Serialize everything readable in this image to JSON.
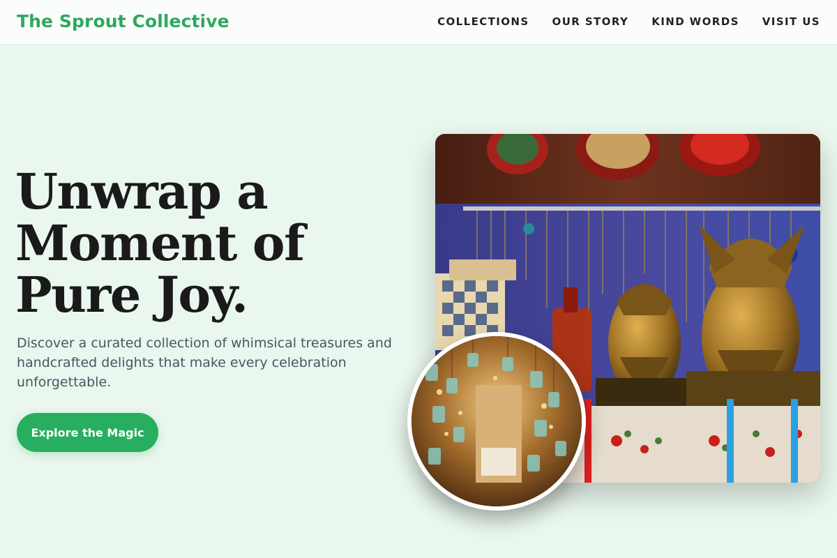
{
  "brand": {
    "name": "The Sprout Collective"
  },
  "nav": {
    "items": [
      {
        "label": "COLLECTIONS"
      },
      {
        "label": "OUR STORY"
      },
      {
        "label": "KIND WORDS"
      },
      {
        "label": "VISIT US"
      }
    ]
  },
  "hero": {
    "headline": "Unwrap a Moment of Pure Joy.",
    "subtitle": "Discover a curated collection of whimsical treasures and handcrafted delights that make every celebration unforgettable.",
    "cta_label": "Explore the Magic"
  },
  "colors": {
    "accent": "#27ae60",
    "brand_text": "#2fa85f",
    "background": "#e9f7ee"
  }
}
